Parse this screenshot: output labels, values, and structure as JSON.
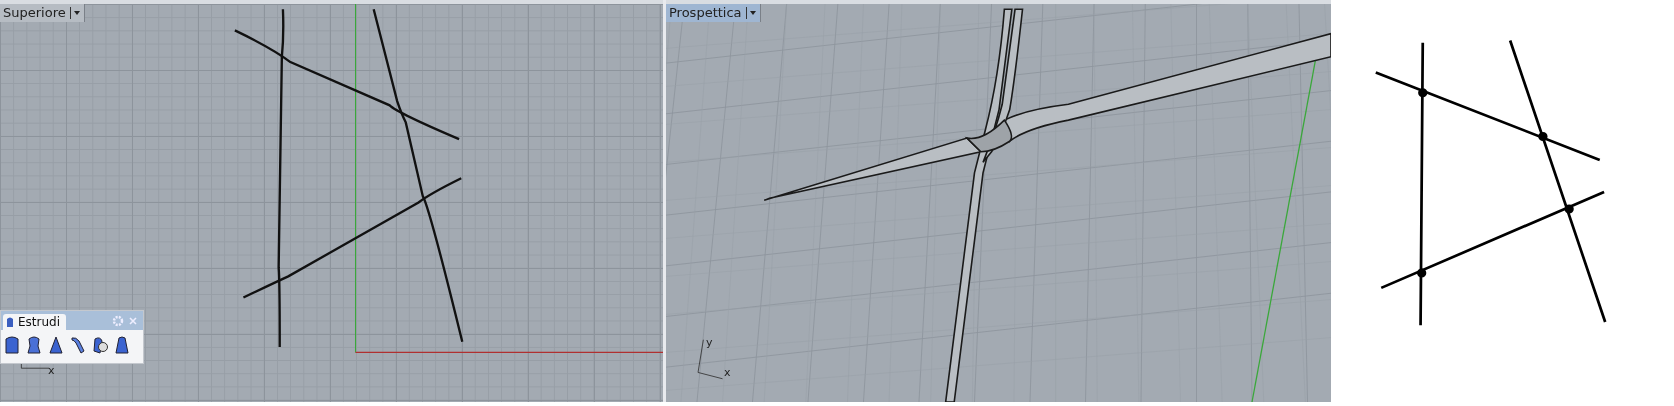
{
  "viewports": [
    {
      "title": "Superiore",
      "kind": "top",
      "axis_labels": [
        "x"
      ]
    },
    {
      "title": "Prospettica",
      "kind": "perspective",
      "axis_labels": [
        "y",
        "x"
      ]
    }
  ],
  "toolbar": {
    "tabs": [
      {
        "label": "Estrudi",
        "selected": true
      }
    ]
  }
}
